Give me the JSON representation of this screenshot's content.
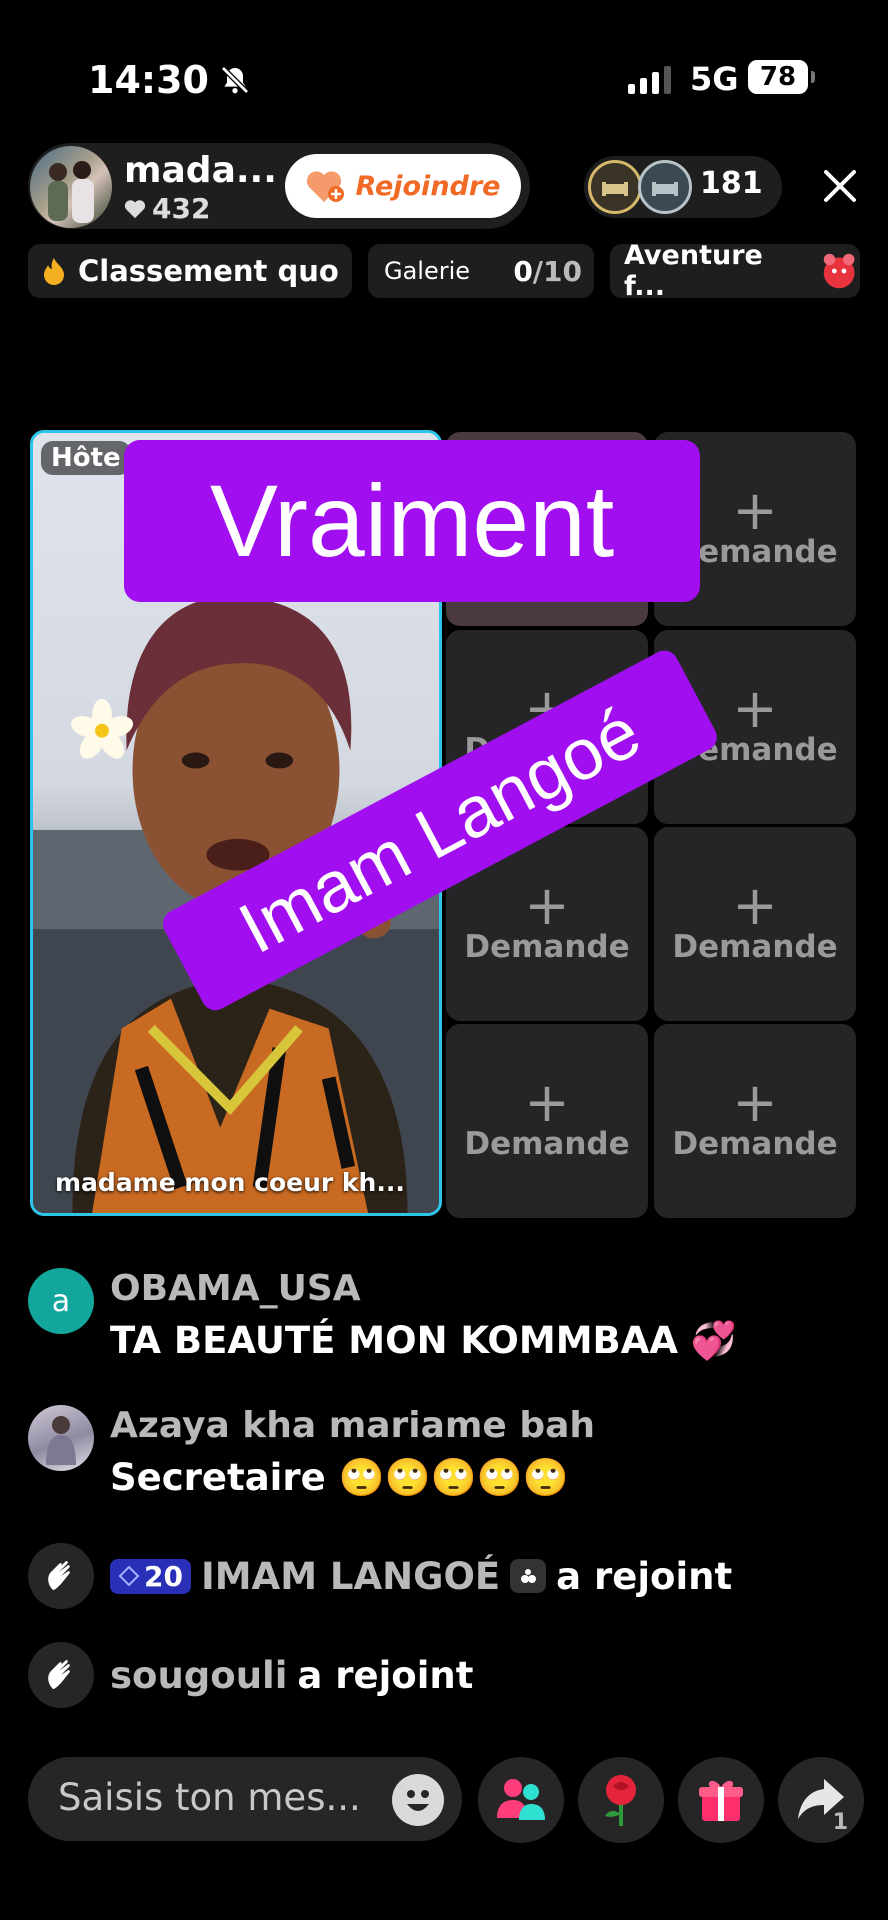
{
  "status_bar": {
    "time": "14:30",
    "network": "5G",
    "battery": "78"
  },
  "header": {
    "host_name": "mada...",
    "likes": "432",
    "join_label": "Rejoindre",
    "viewer_count": "181"
  },
  "tags": {
    "ranking": "Classement quo",
    "gallery_label": "Galerie",
    "gallery_count": "0",
    "gallery_total": "/10",
    "adventure": "Aventure f..."
  },
  "stage": {
    "host_badge": "Hôte",
    "host_caption": "madame mon coeur kh...",
    "slot_label": "Demande",
    "slot_plus": "+"
  },
  "overlays": {
    "top_text": "Vraiment",
    "diagonal_text": "Imam Langoé"
  },
  "chat": {
    "msg1": {
      "avatar_letter": "a",
      "user": "OBAMA_USA",
      "text": "TA BEAUTÉ MON KOMMBAA 💞"
    },
    "msg2": {
      "user": "Azaya kha mariame bah",
      "text": "Secretaire 🙄🙄🙄🙄🙄"
    },
    "join1": {
      "level": "20",
      "user": "IMAM LANGOÉ",
      "action": "a rejoint"
    },
    "join2": {
      "user": "sougouli",
      "action": "a rejoint"
    }
  },
  "bottom_bar": {
    "input_placeholder": "Saisis ton mes...",
    "share_count": "1"
  },
  "colors": {
    "accent_overlay": "#a10ff0",
    "host_border": "#2ec6e8",
    "join_text": "#f06a26",
    "level_badge": "#2a2fb8"
  },
  "icons": [
    "bell-muted-icon",
    "heart-icon",
    "heart-plus-icon",
    "close-icon",
    "flame-icon",
    "gift-bear-icon",
    "wave-hand-icon",
    "smile-icon",
    "guests-icon",
    "rose-icon",
    "gift-icon",
    "share-icon"
  ]
}
